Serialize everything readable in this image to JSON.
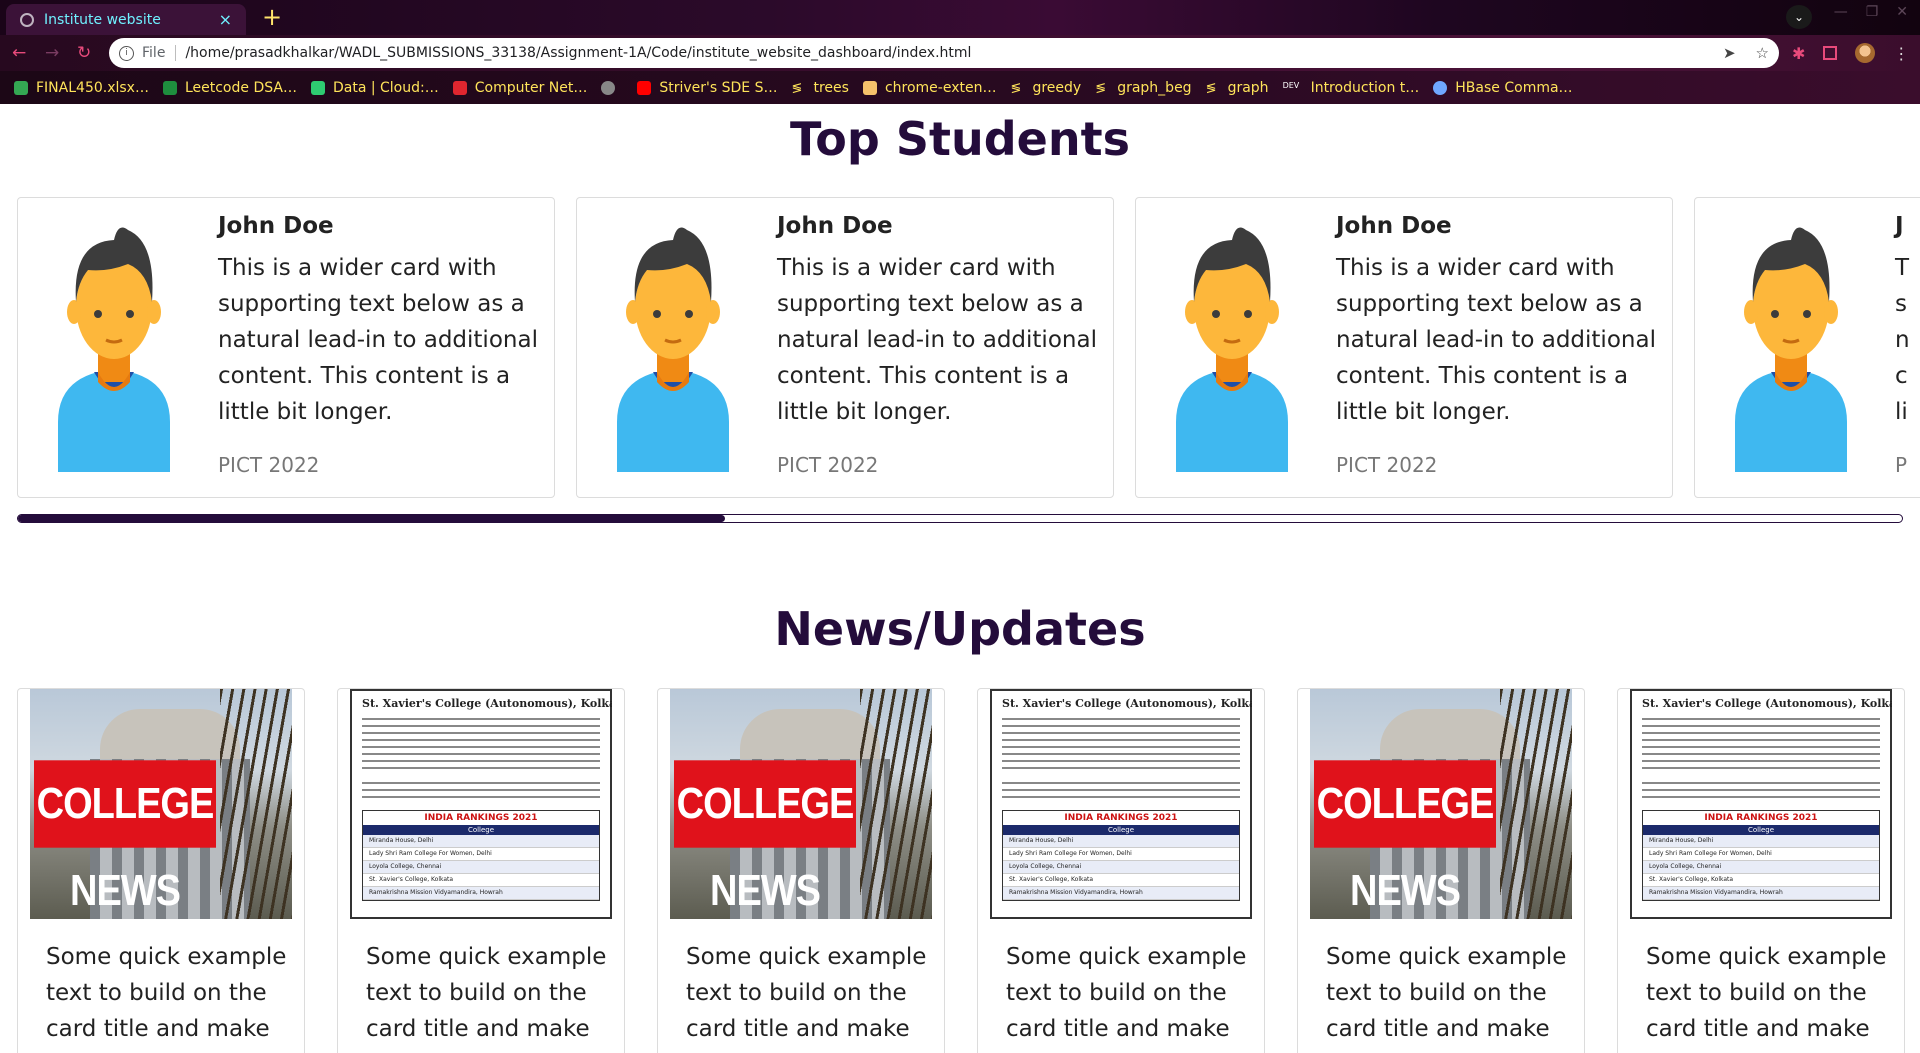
{
  "browser": {
    "tab_title": "Institute website",
    "tab_close": "×",
    "new_tab": "+",
    "url_scheme_label": "File",
    "url": "/home/prasadkhalkar/WADL_SUBMISSIONS_33138/Assignment-1A/Code/institute_website_dashboard/index.html",
    "bookmarks": [
      {
        "label": "FINAL450.xlsx…",
        "icon": "google-drive-icon",
        "color": "#34a853"
      },
      {
        "label": "Leetcode DSA…",
        "icon": "sheets-plus-icon",
        "color": "#1e8e3e"
      },
      {
        "label": "Data | Cloud:…",
        "icon": "leaf-icon",
        "color": "#2ecc71"
      },
      {
        "label": "Computer Net…",
        "icon": "v-logo-icon",
        "color": "#e0262f"
      },
      {
        "label": "",
        "icon": "globe-icon",
        "color": "#888888"
      },
      {
        "label": "Striver's SDE S…",
        "icon": "youtube-icon",
        "color": "#ff0000"
      },
      {
        "label": "trees",
        "icon": "squiggle-icon",
        "color": "#ffe45a"
      },
      {
        "label": "chrome-exten…",
        "icon": "document-icon",
        "color": "#f5c26b"
      },
      {
        "label": "greedy",
        "icon": "squiggle-icon",
        "color": "#ffe45a"
      },
      {
        "label": "graph_beg",
        "icon": "squiggle-icon",
        "color": "#ffe45a"
      },
      {
        "label": "graph",
        "icon": "squiggle-icon",
        "color": "#ffe45a"
      },
      {
        "label": "Introduction t…",
        "icon": "dev-icon",
        "color": "#ffffff"
      },
      {
        "label": "HBase Comma…",
        "icon": "globe-icon",
        "color": "#6fa8ff"
      }
    ]
  },
  "top_students": {
    "title": "Top Students",
    "progress": 0.375,
    "accent": "#240c3b",
    "cards": [
      {
        "name": "John Doe",
        "text": "This is a wider card with supporting text below as a natural lead-in to additional content. This content is a little bit longer.",
        "footer": "PICT 2022"
      },
      {
        "name": "John Doe",
        "text": "This is a wider card with supporting text below as a natural lead-in to additional content. This content is a little bit longer.",
        "footer": "PICT 2022"
      },
      {
        "name": "John Doe",
        "text": "This is a wider card with supporting text below as a natural lead-in to additional content. This content is a little bit longer.",
        "footer": "PICT 2022"
      },
      {
        "name": "J",
        "text": "T s n c li",
        "footer": "P"
      }
    ]
  },
  "news": {
    "title": "News/Updates",
    "college_news_banner": "COLLEGE NEWS",
    "poster_title": "St. Xavier's College (Autonomous), Kolkata",
    "poster_heading": "INDIA RANKINGS 2021",
    "poster_bar": "College",
    "poster_rows": [
      "Miranda House, Delhi",
      "Lady Shri Ram College For Women, Delhi",
      "Loyola College, Chennai",
      "St. Xavier's College, Kolkata",
      "Ramakrishna Mission Vidyamandira, Howrah"
    ],
    "cards": [
      {
        "image": "college-news",
        "text": "Some quick example text to build on the card title and make"
      },
      {
        "image": "rankings",
        "text": "Some quick example text to build on the card title and make"
      },
      {
        "image": "college-news",
        "text": "Some quick example text to build on the card title and make"
      },
      {
        "image": "rankings",
        "text": "Some quick example text to build on the card title and make"
      },
      {
        "image": "college-news",
        "text": "Some quick example text to build on the card title and make"
      },
      {
        "image": "rankings",
        "text": "Some quick example text to build on the card title and make"
      }
    ]
  }
}
